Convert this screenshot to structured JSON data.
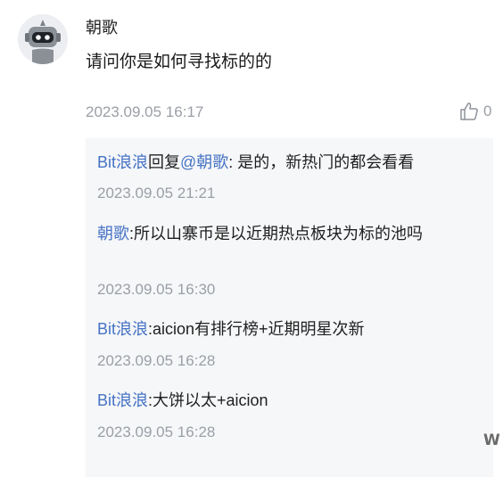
{
  "comment": {
    "username": "朝歌",
    "text": "请问你是如何寻找标的的",
    "timestamp": "2023.09.05 16:17",
    "like_count": "0",
    "like_icon": "thumbs-up-icon",
    "avatar_icon": "robot-avatar-icon"
  },
  "replies": [
    {
      "author": "Bit浪浪",
      "reply_word": "回复",
      "mention": "@朝歌",
      "text": ": 是的，新热门的都会看看",
      "timestamp": "2023.09.05 21:21"
    },
    {
      "author": "朝歌",
      "text": ":所以山寨币是以近期热点板块为标的池吗",
      "timestamp": "2023.09.05 16:30"
    },
    {
      "author": "Bit浪浪",
      "text": ":aicion有排行榜+近期明星次新",
      "timestamp": "2023.09.05 16:28"
    },
    {
      "author": "Bit浪浪",
      "text": ":大饼以太+aicion",
      "timestamp": "2023.09.05 16:28"
    }
  ],
  "watermark": "W",
  "colors": {
    "link": "#4573c4",
    "muted": "#9a9fa6",
    "reply_bg": "#f6f7f9"
  }
}
